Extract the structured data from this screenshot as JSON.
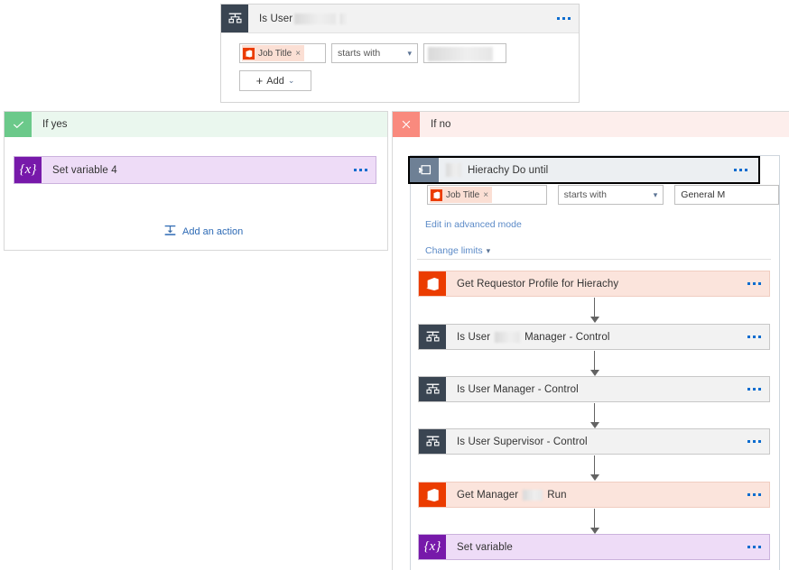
{
  "condition_card": {
    "icon": "control-condition-icon",
    "title": "Is User",
    "title_redacted": true,
    "ellipsis": "more-commands",
    "row": {
      "token": {
        "icon": "office365-icon",
        "label": "Job Title",
        "remove": "×"
      },
      "operator": "starts with",
      "operator_chevron": "⌄",
      "value": "",
      "value_redacted": true
    },
    "add_button": {
      "plus": "+",
      "label": "Add",
      "chevron": "⌄"
    }
  },
  "yes_branch": {
    "icon": "checkmark-icon",
    "label": "If yes",
    "action": {
      "icon": "set-variable-icon",
      "icon_glyph": "{x}",
      "title": "Set variable 4",
      "ellipsis": "more-commands"
    },
    "add_action": {
      "icon": "add-action-icon",
      "label": "Add an action"
    }
  },
  "no_branch": {
    "icon": "cross-icon",
    "label": "If no",
    "do_until": {
      "icon": "do-until-icon",
      "title": "Hierachy Do until",
      "title_redacted": true,
      "ellipsis": "more-commands",
      "condition": {
        "token": {
          "icon": "office365-icon",
          "label": "Job Title",
          "remove": "×"
        },
        "operator": "starts with",
        "operator_chevron": "⌄",
        "value": "General M"
      },
      "advanced_link": "Edit in advanced mode",
      "limits_link": "Change limits",
      "limits_chevron": "⌄",
      "steps": [
        {
          "icon": "office365-icon",
          "kind": "office",
          "title": "Get Requestor Profile for Hierachy",
          "redacted": false,
          "ellipsis": "more-commands"
        },
        {
          "icon": "control-condition-icon",
          "kind": "control",
          "title": "Is User",
          "title_suffix": "Manager - Control",
          "redacted": true,
          "ellipsis": "more-commands"
        },
        {
          "icon": "control-condition-icon",
          "kind": "control",
          "title": "Is User Manager - Control",
          "redacted": false,
          "ellipsis": "more-commands"
        },
        {
          "icon": "control-condition-icon",
          "kind": "control",
          "title": "Is User Supervisor - Control",
          "redacted": false,
          "ellipsis": "more-commands"
        },
        {
          "icon": "office365-icon",
          "kind": "office",
          "title": "Get Manager",
          "title_suffix": "Run",
          "redacted": true,
          "ellipsis": "more-commands"
        },
        {
          "icon": "set-variable-icon",
          "kind": "variable",
          "icon_glyph": "{x}",
          "title": "Set variable",
          "redacted": false,
          "ellipsis": "more-commands"
        }
      ]
    }
  },
  "colors": {
    "office365": "#eb3c00",
    "control": "#3a4552",
    "variable": "#7719aa",
    "do_until": "#6e8095",
    "yes_green": "#6bc98a",
    "no_red": "#f98a7e",
    "card_gray": "#f2f2f2",
    "office_card": "#fbe4dc",
    "variable_card": "#eedcf7",
    "link_blue": "#5b8ac7",
    "ellipsis_blue": "#0b6ccf"
  }
}
